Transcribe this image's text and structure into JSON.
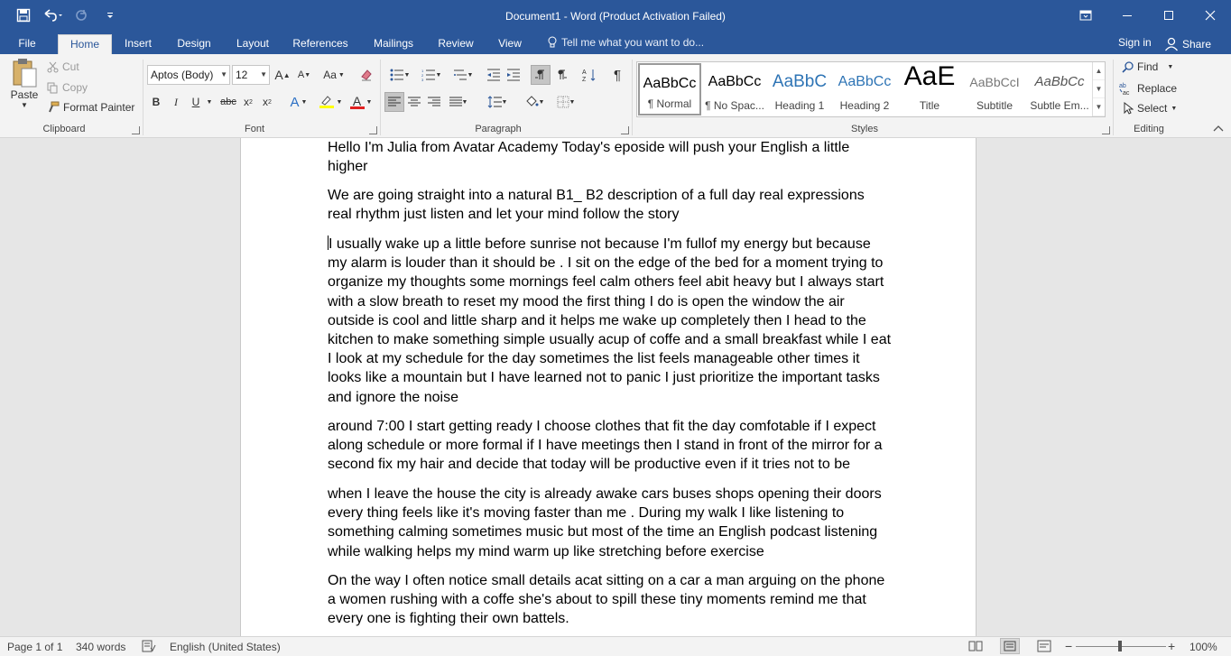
{
  "window": {
    "title": "Document1 - Word (Product Activation Failed)"
  },
  "qat": {
    "save_icon": "save-icon",
    "undo_icon": "undo-icon",
    "redo_icon": "redo-icon",
    "customize_icon": "customize-qat-icon"
  },
  "tabs": [
    {
      "label": "File"
    },
    {
      "label": "Home"
    },
    {
      "label": "Insert"
    },
    {
      "label": "Design"
    },
    {
      "label": "Layout"
    },
    {
      "label": "References"
    },
    {
      "label": "Mailings"
    },
    {
      "label": "Review"
    },
    {
      "label": "View"
    }
  ],
  "tell_me": {
    "placeholder": "Tell me what you want to do..."
  },
  "account": {
    "signin": "Sign in",
    "share": "Share"
  },
  "clipboard": {
    "paste": "Paste",
    "cut": "Cut",
    "copy": "Copy",
    "format_painter": "Format Painter",
    "label": "Clipboard"
  },
  "font": {
    "name": "Aptos (Body)",
    "size": "12",
    "grow": "A",
    "shrink": "A",
    "case": "Aa",
    "bold": "B",
    "italic": "I",
    "underline": "U",
    "strike": "abc",
    "subscript": "x",
    "superscript": "x",
    "text_effects": "A",
    "font_color": "A",
    "label": "Font"
  },
  "paragraph": {
    "label": "Paragraph",
    "pilcrow": "¶"
  },
  "styles": {
    "label": "Styles",
    "items": [
      {
        "sample": "AaBbCc",
        "name": "¶ Normal"
      },
      {
        "sample": "AaBbCc",
        "name": "¶ No Spac..."
      },
      {
        "sample": "AaBbC",
        "name": "Heading 1"
      },
      {
        "sample": "AaBbCc",
        "name": "Heading 2"
      },
      {
        "sample": "AaE",
        "name": "Title"
      },
      {
        "sample": "AaBbCcI",
        "name": "Subtitle"
      },
      {
        "sample": "AaBbCc",
        "name": "Subtle Em..."
      }
    ]
  },
  "editing": {
    "find": "Find",
    "replace": "Replace",
    "select": "Select",
    "label": "Editing"
  },
  "document": {
    "paragraphs": [
      "Hello  I'm Julia from Avatar Academy Today's eposide will push your English a little higher",
      "We are going straight into a natural B1_ B2 description of a full day real expressions real rhythm just listen and let your mind follow the story",
      "I usually wake up a little before sunrise  not because I'm fullof my energy but because my alarm is louder than it should be .  I sit on the edge of the bed for a moment trying to organize my thoughts  some mornings feel calm others feel abit heavy but I always start with a slow breath to reset my mood  the first thing I do is open the window the air outside is cool and little sharp and it helps me wake up completely  then I head to the kitchen to make something simple usually acup of coffe and a small breakfast while I eat I look at my schedule for the day  sometimes the list feels manageable other times it looks like a mountain but I have learned not to panic I just prioritize the important tasks and ignore the noise",
      "around 7:00 I start getting ready I choose clothes that fit the day comfotable if I expect along schedule or more formal if I have meetings then I stand in front of the mirror for a second  fix my hair and decide that today will be productive even if it tries not to be",
      "when I leave the house the city is already awake  cars buses shops opening their doors every thing feels like it's moving faster than me . During my walk I like listening to something calming  sometimes music but most of the time an English podcast listening while walking helps my mind warm up like stretching before exercise",
      "On the way I often notice small details acat sitting on a car a man arguing on the phone a women rushing with a coffe she's about to spill these tiny moments remind me that every one is fighting their own battels."
    ]
  },
  "status": {
    "page": "Page 1 of 1",
    "words": "340 words",
    "language": "English (United States)",
    "zoom": "100%",
    "zoom_minus": "−",
    "zoom_plus": "+"
  }
}
